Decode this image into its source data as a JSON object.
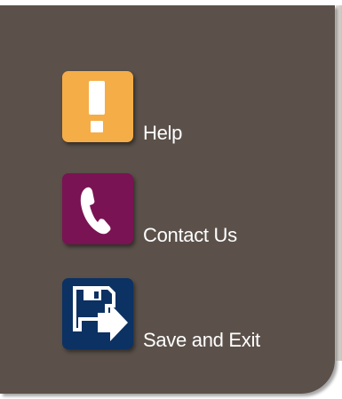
{
  "menu": {
    "items": [
      {
        "label": "Help",
        "icon": "exclamation-icon",
        "color": "#f5ad48"
      },
      {
        "label": "Contact Us",
        "icon": "phone-icon",
        "color": "#7a1353"
      },
      {
        "label": "Save and Exit",
        "icon": "save-exit-icon",
        "color": "#0c3163"
      }
    ]
  },
  "colors": {
    "panel_background": "#5b514a",
    "label_text": "#ffffff"
  }
}
